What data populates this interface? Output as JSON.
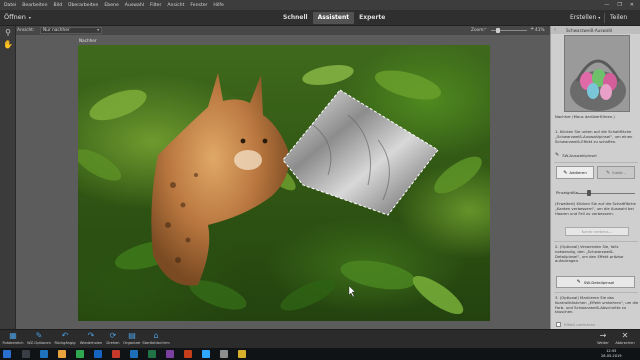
{
  "menu": [
    "Datei",
    "Bearbeiten",
    "Bild",
    "Überarbeiten",
    "Ebene",
    "Auswahl",
    "Filter",
    "Ansicht",
    "Fenster",
    "Hilfe"
  ],
  "window_controls": {
    "minimize": "—",
    "restore": "❐",
    "close": "✕"
  },
  "open_button": {
    "label": "Öffnen",
    "arrow": "▾"
  },
  "modes": {
    "quick": "Schnell",
    "guided": "Assistent",
    "expert": "Experte",
    "active": "Assistent"
  },
  "create_button": {
    "label": "Erstellen",
    "arrow": "▾"
  },
  "share_button": {
    "label": "Teilen"
  },
  "view": {
    "label": "Ansicht:",
    "value": "Nur nachher",
    "dropdown": "▾"
  },
  "zoom": {
    "label": "Zoom:",
    "minus": "–",
    "plus": "+",
    "value": "41%",
    "level": 0.41
  },
  "canvas": {
    "label": "Nachher"
  },
  "tools": [
    {
      "icon": "magnifier-icon",
      "glyph": "⚲"
    },
    {
      "icon": "hand-icon",
      "glyph": "✋"
    }
  ],
  "panel": {
    "back_glyph": "‹",
    "title": "Schwarzweiß-Auswahl",
    "caption": "Nachher (Maus darüberführen.)",
    "step1": "1. Klicken Sie unten auf die Schaltfläche „Schwarzweiß-Auswahlpinsel“, um einen Schwarzweiß-Effekt zu schaffen.",
    "brush_label": "SW-Auswahlpinsel",
    "add_label": "Addieren",
    "subtract_label": "Subtr...",
    "brush_size_label": "Pinselgröße",
    "brush_size_level": 0.2,
    "step_optional1": "(Erweitert) Klicken Sie auf die Schaltfläche „Kanten verbessern“, um die Auswahl bei Haaren und Fell zu verbessern.",
    "refine_edge_label": "Kante verbess...",
    "step2": "2. (Optional) Verwenden Sie, falls notwendig, den „Schwarzweiß-Detailpinsel“, um den Effekt präzise aufzutragen.",
    "detail_brush_label": "SW-Detailpinsel",
    "step3": "3. (Optional) Markieren Sie das Kontrollkästchen „Effekt umkehren“, um die Farb- und Schwarzweiß-Abschnitte zu tauschen.",
    "invert_label": "Effekt umkehren",
    "invert_checked": false
  },
  "bottom_tools": [
    {
      "label": "Fotobereich",
      "icon": "photo-bin-icon",
      "glyph": "▦"
    },
    {
      "label": "WZ-Optionen",
      "icon": "tool-options-icon",
      "glyph": "✎"
    },
    {
      "label": "Rückgängig",
      "icon": "undo-icon",
      "glyph": "↶"
    },
    {
      "label": "Wiederholen",
      "icon": "redo-icon",
      "glyph": "↷"
    },
    {
      "label": "Drehen",
      "icon": "rotate-icon",
      "glyph": "⟳"
    },
    {
      "label": "Organizer",
      "icon": "organizer-icon",
      "glyph": "▤"
    },
    {
      "label": "Startbildschirm",
      "icon": "home-screen-icon",
      "glyph": "⌂"
    }
  ],
  "bottom_nav": {
    "next": "Weiter",
    "cancel": "Abbrechen"
  },
  "clock": {
    "time": "12:55",
    "date": "28.05.2019"
  }
}
